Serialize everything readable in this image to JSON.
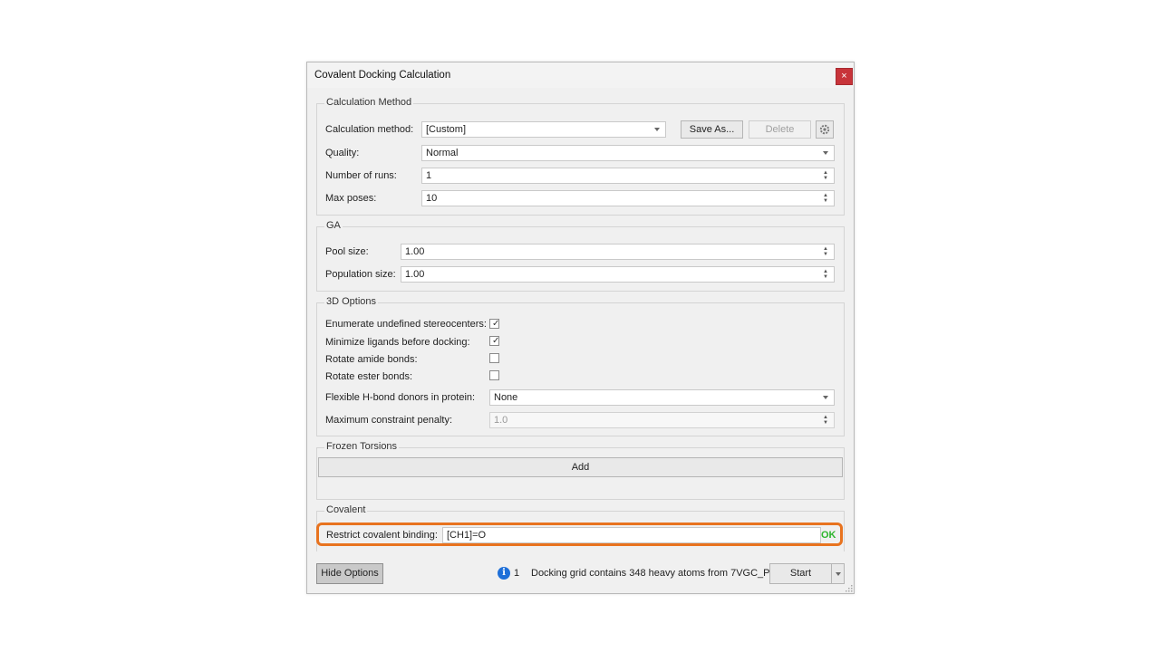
{
  "dialog": {
    "title": "Covalent Docking Calculation",
    "close_glyph": "×"
  },
  "calc": {
    "group_title": "Calculation Method",
    "method_label": "Calculation method:",
    "method_value": "[Custom]",
    "save_as": "Save As...",
    "delete": "Delete",
    "quality_label": "Quality:",
    "quality_value": "Normal",
    "runs_label": "Number of runs:",
    "runs_value": "1",
    "poses_label": "Max poses:",
    "poses_value": "10"
  },
  "ga": {
    "group_title": "GA",
    "pool_label": "Pool size:",
    "pool_value": "1.00",
    "population_label": "Population size:",
    "population_value": "1.00"
  },
  "options3d": {
    "group_title": "3D Options",
    "enumerate_label": "Enumerate undefined stereocenters:",
    "enumerate_checked": true,
    "minimize_label": "Minimize ligands before docking:",
    "minimize_checked": true,
    "amide_label": "Rotate amide bonds:",
    "amide_checked": false,
    "ester_label": "Rotate ester bonds:",
    "ester_checked": false,
    "flex_label": "Flexible H-bond donors in protein:",
    "flex_value": "None",
    "penalty_label": "Maximum constraint penalty:",
    "penalty_value": "1.0"
  },
  "frozen": {
    "group_title": "Frozen Torsions",
    "add": "Add"
  },
  "covalent": {
    "group_title": "Covalent",
    "restrict_label": "Restrict covalent binding:",
    "restrict_value": "[CH1]=O",
    "status": "OK"
  },
  "footer": {
    "hide_options": "Hide Options",
    "info_glyph": "i",
    "info_count": "1",
    "status_text": "Docking grid contains 348 heavy atoms from 7VGC_P",
    "start": "Start"
  },
  "colors": {
    "highlight": "#e8731f",
    "ok": "#2db52d",
    "close": "#c8343a",
    "info": "#1e6fd8"
  }
}
